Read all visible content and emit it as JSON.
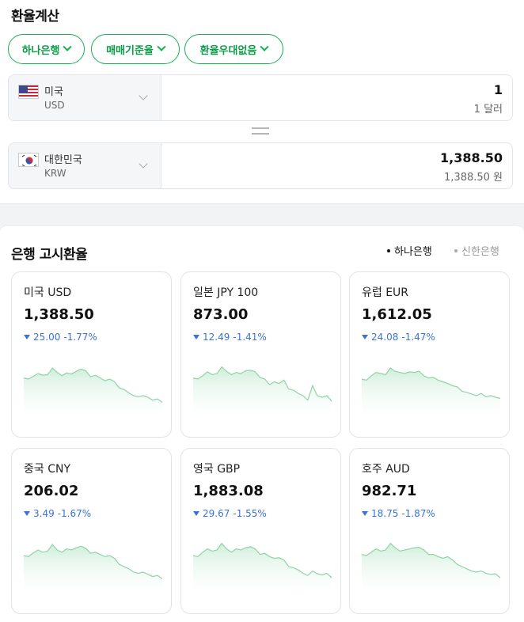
{
  "calculator": {
    "title": "환율계산",
    "chips": [
      "하나은행",
      "매매기준율",
      "환율우대없음"
    ],
    "from": {
      "name": "미국",
      "code": "USD",
      "amount": "1",
      "amount_sub": "1 달러"
    },
    "to": {
      "name": "대한민국",
      "code": "KRW",
      "amount": "1,388.50",
      "amount_sub": "1,388.50 원"
    }
  },
  "rates": {
    "title": "은행 고시환율",
    "banks": [
      "하나은행",
      "신한은행"
    ],
    "active_bank": "하나은행",
    "cards": [
      {
        "currency": "미국 USD",
        "rate": "1,388.50",
        "change": "25.00",
        "pct": "-1.77%",
        "trend": [
          0.62,
          0.6,
          0.65,
          0.7,
          0.67,
          0.68,
          0.8,
          0.72,
          0.66,
          0.71,
          0.69,
          0.74,
          0.78,
          0.75,
          0.64,
          0.67,
          0.62,
          0.57,
          0.6,
          0.55,
          0.44,
          0.41,
          0.35,
          0.3,
          0.28,
          0.3,
          0.27,
          0.22,
          0.24,
          0.18
        ]
      },
      {
        "currency": "일본 JPY 100",
        "rate": "873.00",
        "change": "12.49",
        "pct": "-1.41%",
        "trend": [
          0.62,
          0.6,
          0.66,
          0.73,
          0.68,
          0.7,
          0.82,
          0.74,
          0.68,
          0.72,
          0.7,
          0.75,
          0.76,
          0.73,
          0.63,
          0.6,
          0.5,
          0.55,
          0.52,
          0.58,
          0.42,
          0.4,
          0.34,
          0.3,
          0.22,
          0.48,
          0.3,
          0.27,
          0.3,
          0.2
        ]
      },
      {
        "currency": "유럽 EUR",
        "rate": "1,612.05",
        "change": "24.08",
        "pct": "-1.47%",
        "trend": [
          0.6,
          0.58,
          0.66,
          0.72,
          0.7,
          0.68,
          0.8,
          0.74,
          0.72,
          0.7,
          0.73,
          0.72,
          0.74,
          0.66,
          0.62,
          0.63,
          0.58,
          0.55,
          0.52,
          0.48,
          0.46,
          0.38,
          0.36,
          0.33,
          0.3,
          0.34,
          0.28,
          0.3,
          0.27,
          0.25
        ]
      },
      {
        "currency": "중국 CNY",
        "rate": "206.02",
        "change": "3.49",
        "pct": "-1.67%",
        "trend": [
          0.6,
          0.58,
          0.65,
          0.7,
          0.66,
          0.68,
          0.8,
          0.7,
          0.66,
          0.72,
          0.7,
          0.74,
          0.77,
          0.73,
          0.64,
          0.66,
          0.62,
          0.58,
          0.6,
          0.55,
          0.44,
          0.4,
          0.36,
          0.3,
          0.28,
          0.3,
          0.26,
          0.22,
          0.24,
          0.18
        ]
      },
      {
        "currency": "영국 GBP",
        "rate": "1,883.08",
        "change": "29.67",
        "pct": "-1.55%",
        "trend": [
          0.6,
          0.58,
          0.66,
          0.72,
          0.68,
          0.7,
          0.82,
          0.72,
          0.66,
          0.72,
          0.7,
          0.74,
          0.76,
          0.72,
          0.62,
          0.64,
          0.58,
          0.55,
          0.56,
          0.52,
          0.4,
          0.38,
          0.34,
          0.28,
          0.24,
          0.32,
          0.27,
          0.25,
          0.28,
          0.2
        ]
      },
      {
        "currency": "호주 AUD",
        "rate": "982.71",
        "change": "18.75",
        "pct": "-1.87%",
        "trend": [
          0.62,
          0.6,
          0.66,
          0.72,
          0.68,
          0.7,
          0.82,
          0.74,
          0.68,
          0.7,
          0.72,
          0.74,
          0.75,
          0.7,
          0.62,
          0.62,
          0.58,
          0.55,
          0.58,
          0.52,
          0.44,
          0.4,
          0.36,
          0.32,
          0.3,
          0.32,
          0.28,
          0.26,
          0.27,
          0.2
        ]
      }
    ]
  },
  "colors": {
    "accent": "#16b155",
    "down": "#3b73d8",
    "chart_line": "#8fd3a8"
  },
  "icons": {
    "chip_arrow": "chevron-down-icon",
    "change_arrow": "triangle-down-icon"
  }
}
